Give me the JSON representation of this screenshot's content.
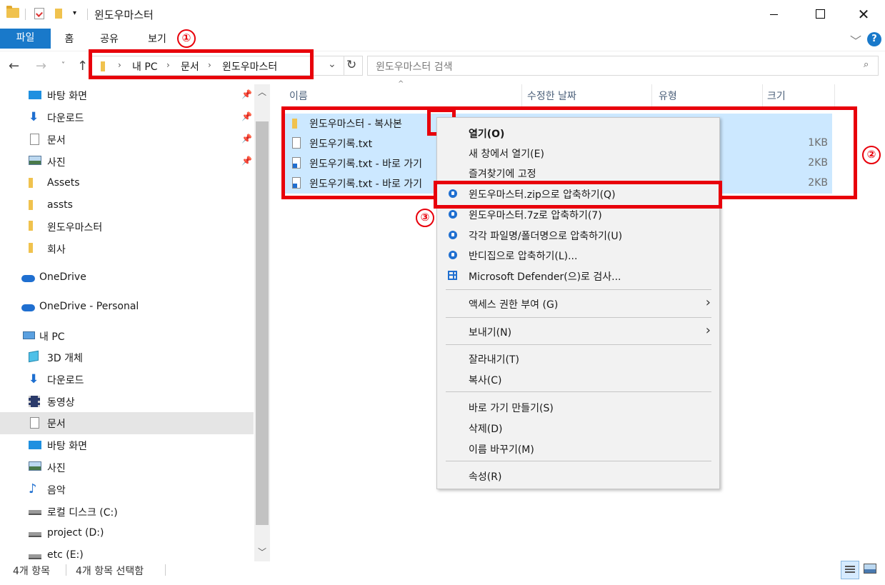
{
  "window": {
    "title": "윈도우마스터"
  },
  "ribbon": {
    "tabs": [
      {
        "label": "파일"
      },
      {
        "label": "홈"
      },
      {
        "label": "공유"
      },
      {
        "label": "보기"
      }
    ]
  },
  "address": {
    "crumbs": [
      "내 PC",
      "문서",
      "윈도우마스터"
    ],
    "search_placeholder": "윈도우마스터 검색"
  },
  "nav": {
    "items": [
      {
        "label": "바탕 화면",
        "icon": "desktop-icon",
        "pinned": true
      },
      {
        "label": "다운로드",
        "icon": "download-icon",
        "pinned": true
      },
      {
        "label": "문서",
        "icon": "document-icon",
        "pinned": true
      },
      {
        "label": "사진",
        "icon": "picture-icon",
        "pinned": true
      },
      {
        "label": "Assets",
        "icon": "folder-icon"
      },
      {
        "label": "assts",
        "icon": "folder-icon"
      },
      {
        "label": "윈도우마스터",
        "icon": "folder-icon"
      },
      {
        "label": "회사",
        "icon": "folder-icon"
      },
      {
        "label": "OneDrive",
        "icon": "cloud-icon"
      },
      {
        "label": "OneDrive - Personal",
        "icon": "cloud-icon"
      },
      {
        "label": "내 PC",
        "icon": "pc-icon"
      },
      {
        "label": "3D 개체",
        "icon": "cube-icon"
      },
      {
        "label": "다운로드",
        "icon": "download-icon"
      },
      {
        "label": "동영상",
        "icon": "video-icon"
      },
      {
        "label": "문서",
        "icon": "document-icon",
        "selected": true
      },
      {
        "label": "바탕 화면",
        "icon": "desktop-icon"
      },
      {
        "label": "사진",
        "icon": "picture-icon"
      },
      {
        "label": "음악",
        "icon": "music-icon"
      },
      {
        "label": "로컬 디스크 (C:)",
        "icon": "drive-icon"
      },
      {
        "label": "project (D:)",
        "icon": "drive-icon"
      },
      {
        "label": "etc (E:)",
        "icon": "drive-icon"
      }
    ]
  },
  "columns": {
    "name": "이름",
    "modified": "수정한 날짜",
    "type": "유형",
    "size": "크기"
  },
  "files": [
    {
      "name": "윈도우마스터 - 복사본",
      "size": "",
      "icon": "folder-icon"
    },
    {
      "name": "윈도우기록.txt",
      "size": "1KB",
      "icon": "text-file-icon"
    },
    {
      "name": "윈도우기록.txt - 바로 가기",
      "size": "2KB",
      "icon": "shortcut-icon"
    },
    {
      "name": "윈도우기록.txt - 바로 가기",
      "size": "2KB",
      "icon": "shortcut-icon"
    }
  ],
  "context_menu": {
    "items": [
      {
        "label": "열기(O)",
        "bold": true
      },
      {
        "label": "새 창에서 열기(E)"
      },
      {
        "label": "즐겨찾기에 고정"
      },
      {
        "label": "윈도우마스터.zip으로 압축하기(Q)",
        "icon": "bandizip-icon"
      },
      {
        "label": "윈도우마스터.7z로 압축하기(7)",
        "icon": "bandizip-icon"
      },
      {
        "label": "각각 파일명/폴더명으로 압축하기(U)",
        "icon": "bandizip-icon"
      },
      {
        "label": "반디집으로 압축하기(L)...",
        "icon": "bandizip-icon"
      },
      {
        "label": "Microsoft Defender(으)로 검사...",
        "icon": "defender-icon"
      },
      {
        "label": "액세스 권한 부여 (G)",
        "submenu": true
      },
      {
        "label": "보내기(N)",
        "submenu": true
      },
      {
        "label": "잘라내기(T)"
      },
      {
        "label": "복사(C)"
      },
      {
        "label": "바로 가기 만들기(S)"
      },
      {
        "label": "삭제(D)"
      },
      {
        "label": "이름 바꾸기(M)"
      },
      {
        "label": "속성(R)"
      }
    ]
  },
  "annotations": {
    "marker1": "①",
    "marker2": "②",
    "marker3": "③"
  },
  "status": {
    "count": "4개 항목",
    "selected": "4개 항목 선택함"
  },
  "colors": {
    "accent": "#1979ca",
    "selection": "#cce8ff",
    "annotation_red": "#e8000b"
  }
}
